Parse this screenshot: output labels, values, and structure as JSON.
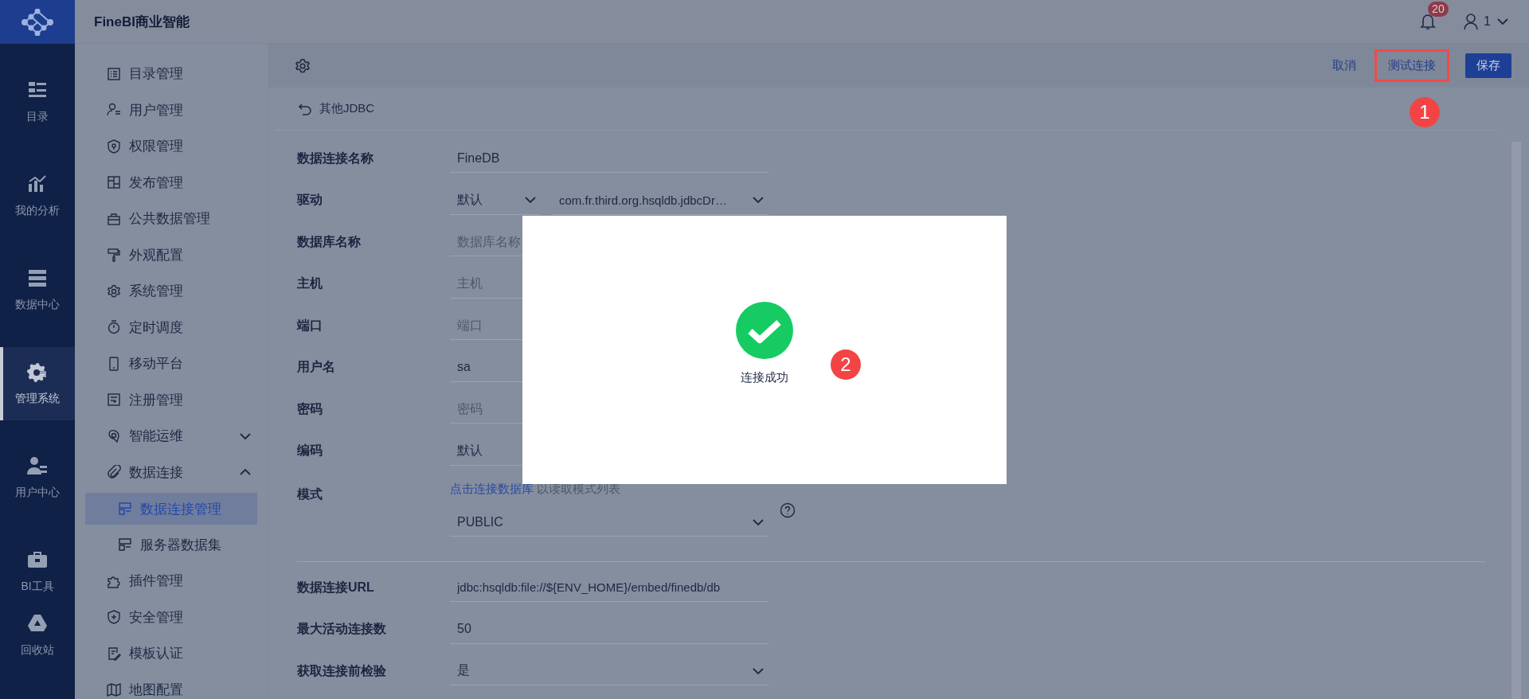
{
  "app": {
    "title": "FineBI商业智能"
  },
  "header": {
    "notification_count": "20",
    "user_name": "1"
  },
  "rail": [
    {
      "label": "目录",
      "selected": false
    },
    {
      "label": "我的分析",
      "selected": false
    },
    {
      "label": "数据中心",
      "selected": false
    },
    {
      "label": "管理系统",
      "selected": true
    },
    {
      "label": "用户中心",
      "selected": false
    },
    {
      "label": "BI工具",
      "selected": false
    },
    {
      "label": "回收站",
      "selected": false
    }
  ],
  "menu": [
    {
      "label": "目录管理",
      "selected": false
    },
    {
      "label": "用户管理",
      "selected": false
    },
    {
      "label": "权限管理",
      "selected": false
    },
    {
      "label": "发布管理",
      "selected": false
    },
    {
      "label": "公共数据管理",
      "selected": false
    },
    {
      "label": "外观配置",
      "selected": false
    },
    {
      "label": "系统管理",
      "selected": false
    },
    {
      "label": "定时调度",
      "selected": false
    },
    {
      "label": "移动平台",
      "selected": false
    },
    {
      "label": "注册管理",
      "selected": false
    },
    {
      "label": "智能运维",
      "selected": false,
      "expanded": false
    },
    {
      "label": "数据连接",
      "selected": false,
      "expanded": true,
      "children": [
        {
          "label": "数据连接管理",
          "selected": true
        },
        {
          "label": "服务器数据集",
          "selected": false
        }
      ]
    },
    {
      "label": "插件管理",
      "selected": false
    },
    {
      "label": "安全管理",
      "selected": false
    },
    {
      "label": "模板认证",
      "selected": false
    },
    {
      "label": "地图配置",
      "selected": false
    }
  ],
  "toolbar": {
    "buttons": [
      {
        "label": "取消",
        "kind": "link",
        "outlined": false
      },
      {
        "label": "测试连接",
        "kind": "link",
        "outlined": true
      },
      {
        "label": "保存",
        "kind": "primary",
        "outlined": false
      }
    ]
  },
  "back": {
    "label": "其他JDBC"
  },
  "form": {
    "sections": [
      {
        "fields": [
          {
            "label": "数据连接名称",
            "kind": "text",
            "value": "FineDB"
          },
          {
            "label": "驱动",
            "kind": "double_select",
            "values": [
              "默认",
              "com.fr.third.org.hsqldb.jdbcDr…"
            ]
          },
          {
            "label": "数据库名称",
            "kind": "text",
            "placeholder": "数据库名称"
          },
          {
            "label": "主机",
            "kind": "text",
            "placeholder": "主机"
          },
          {
            "label": "端口",
            "kind": "text",
            "placeholder": "端口"
          },
          {
            "label": "用户名",
            "kind": "text",
            "value": "sa"
          },
          {
            "label": "密码",
            "kind": "text",
            "placeholder": "密码"
          },
          {
            "label": "编码",
            "kind": "text",
            "value": "默认"
          },
          {
            "label": "模式",
            "kind": "schema",
            "link": "点击连接数据库",
            "hint": "以读取模式列表",
            "value": "PUBLIC"
          }
        ]
      },
      {
        "fields": [
          {
            "label": "数据连接URL",
            "kind": "text",
            "value": "jdbc:hsqldb:file://${ENV_HOME}/embed/finedb/db"
          },
          {
            "label": "最大活动连接数",
            "kind": "text",
            "value": "50"
          },
          {
            "label": "获取连接前检验",
            "kind": "select",
            "value": "是"
          }
        ]
      }
    ]
  },
  "dialog": {
    "message": "连接成功"
  },
  "callouts": [
    {
      "label": "1"
    },
    {
      "label": "2"
    }
  ]
}
